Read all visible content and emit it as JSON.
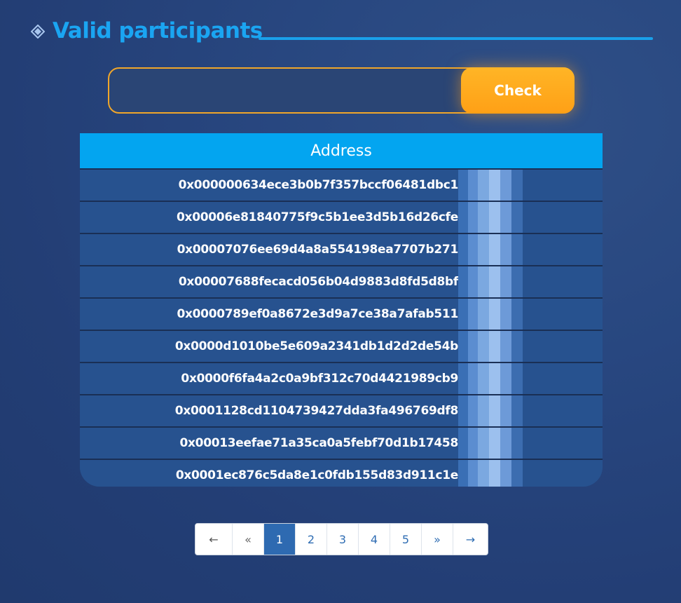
{
  "header": {
    "title": "Valid participants"
  },
  "search": {
    "placeholder": "",
    "value": "",
    "button_label": "Check"
  },
  "table": {
    "column_header": "Address",
    "rows": [
      "0x000000634ece3b0b7f357bccf06481dbc1",
      "0x00006e81840775f9c5b1ee3d5b16d26cfe",
      "0x00007076ee69d4a8a554198ea7707b271",
      "0x00007688fecacd056b04d9883d8fd5d8bf",
      "0x0000789ef0a8672e3d9a7ce38a7afab511",
      "0x0000d1010be5e609a2341db1d2d2de54b",
      "0x0000f6fa4a2c0a9bf312c70d4421989cb9",
      "0x0001128cd1104739427dda3fa496769df8",
      "0x00013eefae71a35ca0a5febf70d1b17458",
      "0x0001ec876c5da8e1c0fdb155d83d911c1e"
    ]
  },
  "pagination": {
    "first": "←",
    "prev": "«",
    "pages": [
      "1",
      "2",
      "3",
      "4",
      "5"
    ],
    "active_page": "1",
    "next": "»",
    "last": "→"
  }
}
